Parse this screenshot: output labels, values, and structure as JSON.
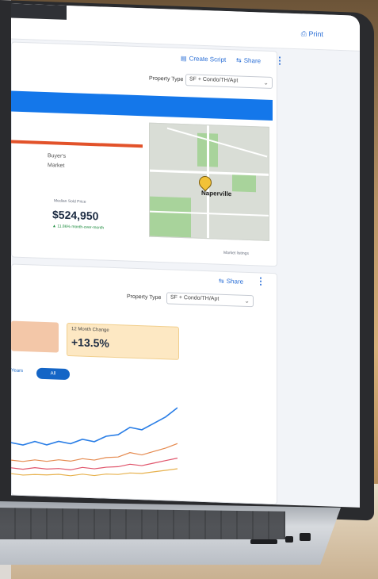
{
  "header": {
    "print_label": "Print"
  },
  "section1": {
    "create_script_label": "Create Script",
    "share_label": "Share",
    "property_type_label": "Property Type",
    "property_type_value": "SF + Condo/TH/Apt",
    "market_label": "Buyer's Market",
    "median_label": "Median Sold Price",
    "median_value": "$524,950",
    "median_change": "▲ 11.86% month-over-month",
    "map_label": "Naperville",
    "map_footnote": "Market listings"
  },
  "section2": {
    "share_label": "Share",
    "property_type_label": "Property Type",
    "property_type_value": "SF + Condo/TH/Apt",
    "change_label": "12 Month Change",
    "change_value": "+13.5%",
    "years_label": "Years",
    "all_label": "All"
  },
  "chart_data": {
    "type": "line",
    "series": [
      {
        "values": [
          38,
          36,
          40,
          37,
          41,
          39,
          44,
          42,
          48,
          50,
          58,
          56,
          63,
          70,
          80
        ]
      },
      {
        "values": [
          20,
          19,
          21,
          20,
          22,
          21,
          24,
          23,
          26,
          27,
          32,
          30,
          34,
          38,
          43
        ]
      },
      {
        "values": [
          12,
          11,
          13,
          12,
          13,
          12,
          15,
          14,
          16,
          17,
          20,
          19,
          22,
          25,
          28
        ]
      },
      {
        "values": [
          6,
          5,
          6,
          6,
          7,
          6,
          8,
          7,
          9,
          9,
          11,
          11,
          13,
          15,
          17
        ]
      }
    ],
    "colors": [
      "#2a7ee6",
      "#e58a4f",
      "#e0546b",
      "#e7b24f"
    ],
    "ylim": [
      0,
      90
    ]
  }
}
